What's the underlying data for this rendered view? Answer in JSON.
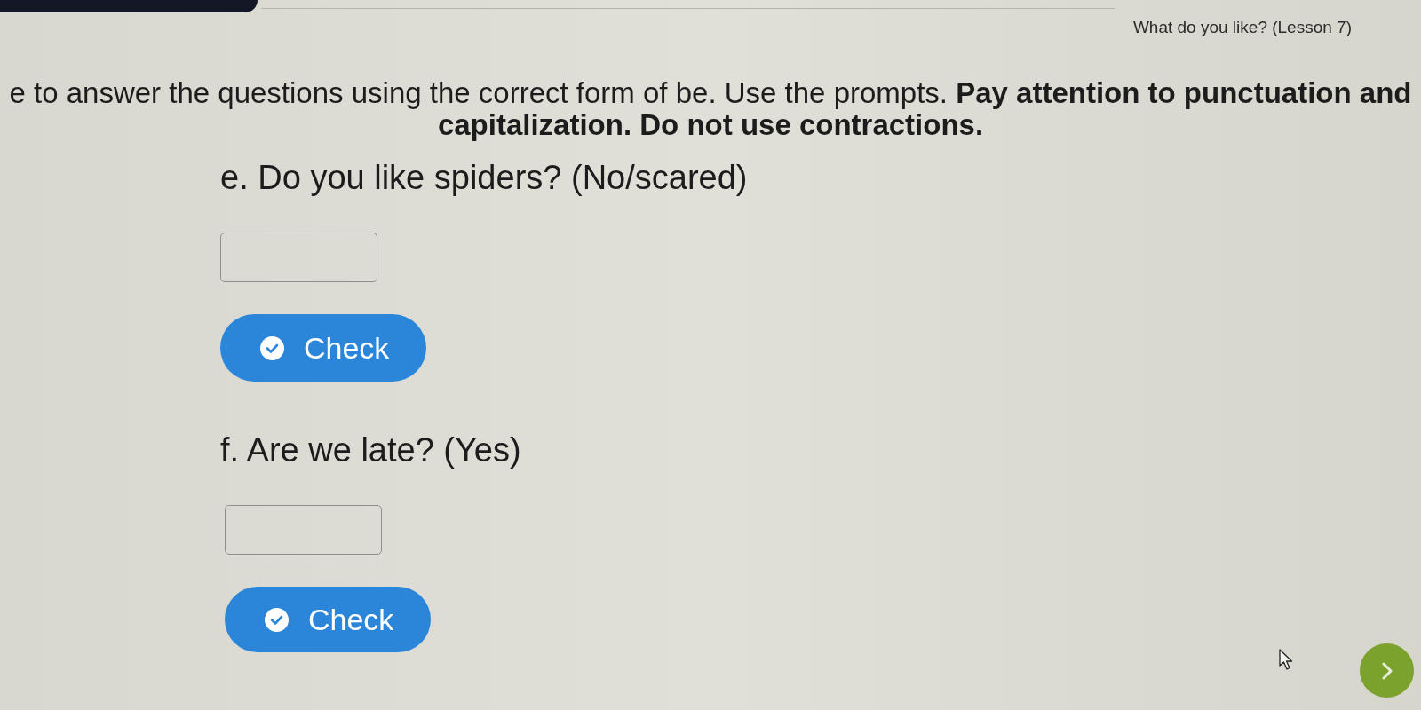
{
  "header": {
    "title": "What do you like? (Lesson 7)"
  },
  "instructions": "e to answer the questions using the correct form of be. Use the prompts. **Pay attention to punctuation and**\n**capitalization. Do not use contractions.**",
  "questions": [
    {
      "prompt": "e. Do you like spiders? (No/scared)",
      "button": "Check"
    },
    {
      "prompt": "f. Are we late? (Yes)",
      "button": "Check"
    }
  ]
}
